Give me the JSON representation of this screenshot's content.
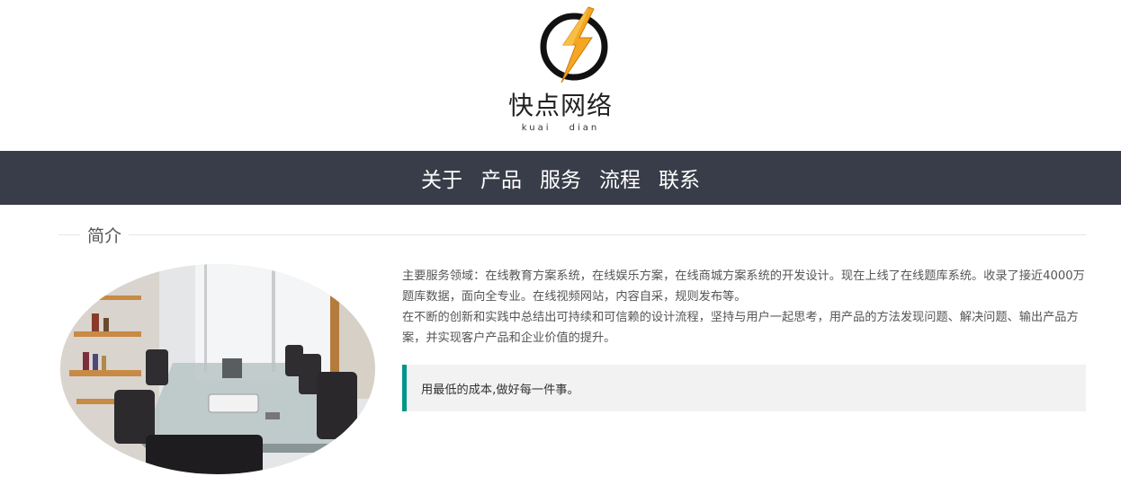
{
  "logo": {
    "icon": "lightning-bolt-icon",
    "name": "快点网络",
    "sub": "kuai dian",
    "colors": {
      "bolt": "#f5a623",
      "ring": "#111111"
    }
  },
  "nav": {
    "background": "#393d49",
    "items": [
      {
        "label": "关于"
      },
      {
        "label": "产品"
      },
      {
        "label": "服务"
      },
      {
        "label": "流程"
      },
      {
        "label": "联系"
      }
    ]
  },
  "intro": {
    "section_title": "简介",
    "photo_alt": "conference-room-photo",
    "paragraphs": [
      "主要服务领域：在线教育方案系统，在线娱乐方案，在线商城方案系统的开发设计。现在上线了在线题库系统。收录了接近4000万题库数据，面向全专业。在线视频网站，内容自采，规则发布等。",
      "在不断的创新和实践中总结出可持续和可信赖的设计流程，坚持与用户一起思考，用产品的方法发现问题、解决问题、输出产品方案，并实现客户产品和企业价值的提升。"
    ],
    "quote": "用最低的成本,做好每一件事。",
    "accent": "#009688"
  }
}
